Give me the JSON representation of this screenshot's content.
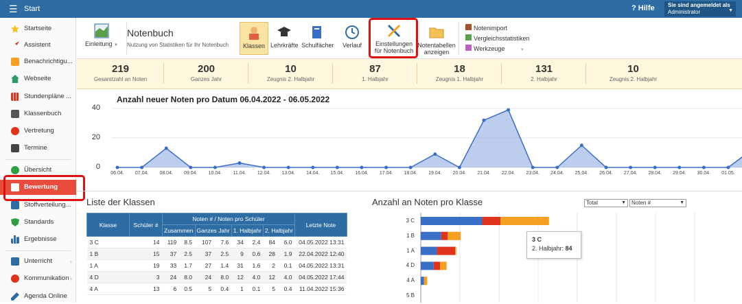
{
  "topbar": {
    "title": "Start",
    "help": "Hilfe",
    "login_label": "Sie sind angemeldet als",
    "user": "Administrator"
  },
  "sidebar": {
    "items": [
      "Startseite",
      "Assistent",
      "Benachrichtigu...",
      "Webseite",
      "Stundenpläne ...",
      "Klassenbuch",
      "Vertretung",
      "Termine",
      "Übersicht",
      "Bewertung",
      "Stoffverteilung...",
      "Standards",
      "Ergebnisse",
      "Unterricht",
      "Kommunikation",
      "Agenda Online"
    ]
  },
  "ribbon": {
    "intro": "Einleitung",
    "title": "Notenbuch",
    "subtitle": "Nutzung von Statistiken für Ihr Notenbuch",
    "buttons": [
      "Klassen",
      "Lehrkräfte",
      "Schulfächer",
      "Verlauf"
    ],
    "settings_l1": "Einstellungen",
    "settings_l2": "für Notenbuch",
    "tables_l1": "Notentabellen",
    "tables_l2": "anzeigen",
    "links": [
      "Notenimport",
      "Vergleichsstatistiken",
      "Werkzeuge"
    ]
  },
  "kpis": [
    {
      "value": "219",
      "label": "Gesamtzahl an Noten"
    },
    {
      "value": "200",
      "label": "Ganzes Jahr"
    },
    {
      "value": "10",
      "label": "Zeugnis 2. Halbjahr"
    },
    {
      "value": "87",
      "label": "1. Halbjahr"
    },
    {
      "value": "18",
      "label": "Zeugnis 1. Halbjahr"
    },
    {
      "value": "131",
      "label": "2. Halbjahr"
    },
    {
      "value": "10",
      "label": "Zeugnis 2. Halbjahr"
    }
  ],
  "chart_data": [
    {
      "type": "area",
      "title": "Anzahl neuer Noten pro Datum 06.04.2022 - 06.05.2022",
      "ylim": [
        0,
        40
      ],
      "yticks": [
        "0",
        "20",
        "40"
      ],
      "x": [
        "06.04.",
        "07.04.",
        "08.04.",
        "09.04.",
        "10.04.",
        "11.04.",
        "12.04.",
        "13.04.",
        "14.04.",
        "15.04.",
        "16.04.",
        "17.04.",
        "18.04.",
        "19.04.",
        "20.04.",
        "21.04.",
        "22.04.",
        "23.04.",
        "24.04.",
        "25.04.",
        "26.04.",
        "27.04.",
        "28.04.",
        "29.04.",
        "30.04.",
        "01.05."
      ],
      "values": [
        0,
        0,
        13,
        0,
        0,
        3,
        0,
        0,
        0,
        0,
        0,
        0,
        0,
        9,
        0,
        32,
        39,
        0,
        0,
        15,
        0,
        0,
        0,
        0,
        0,
        0
      ]
    },
    {
      "type": "bar",
      "title": "Anzahl an Noten pro Klasse",
      "categories": [
        "3 C",
        "1 B",
        "1 A",
        "4 D",
        "4 A",
        "5 B"
      ],
      "series": [
        {
          "name": "Ganzes Jahr",
          "color": "#3a6fc8",
          "values": [
            57,
            19,
            15,
            12,
            3,
            0
          ]
        },
        {
          "name": "1. Halbjahr",
          "color": "#e0331c",
          "values": [
            17,
            6,
            17,
            6,
            0,
            0
          ]
        },
        {
          "name": "2. Halbjahr",
          "color": "#f5a020",
          "values": [
            45,
            12,
            1,
            6,
            3,
            0
          ]
        }
      ],
      "tooltip": {
        "category": "3 C",
        "label": "2. Halbjahr:",
        "value": "84"
      }
    }
  ],
  "classes": {
    "title": "Liste der Klassen",
    "headers": {
      "klasse": "Klasse",
      "schueler": "Schüler #",
      "group": "Noten # / Noten pro Schüler",
      "zus": "Zusammen",
      "gj": "Ganzes Jahr",
      "h1": "1. Halbjahr",
      "h2": "2. Halbjahr",
      "last": "Letzte Note"
    },
    "rows": [
      [
        "3 C",
        "14",
        "119",
        "8.5",
        "107",
        "7.6",
        "34",
        "2.4",
        "84",
        "6.0",
        "04.05.2022 13:31"
      ],
      [
        "1 B",
        "15",
        "37",
        "2.5",
        "37",
        "2.5",
        "9",
        "0.6",
        "28",
        "1.9",
        "22.04.2022 12:40"
      ],
      [
        "1 A",
        "19",
        "33",
        "1.7",
        "27",
        "1.4",
        "31",
        "1.6",
        "2",
        "0.1",
        "04.05.2022 13:31"
      ],
      [
        "4 D",
        "3",
        "24",
        "8.0",
        "24",
        "8.0",
        "12",
        "4.0",
        "12",
        "4.0",
        "04.05.2022 17:44"
      ],
      [
        "4 A",
        "13",
        "6",
        "0.5",
        "5",
        "0.4",
        "1",
        "0.1",
        "5",
        "0.4",
        "11.04.2022 15:36"
      ]
    ]
  },
  "barpanel": {
    "title": "Anzahl an Noten pro Klasse",
    "select1": "Total",
    "select2": "Noten #"
  }
}
